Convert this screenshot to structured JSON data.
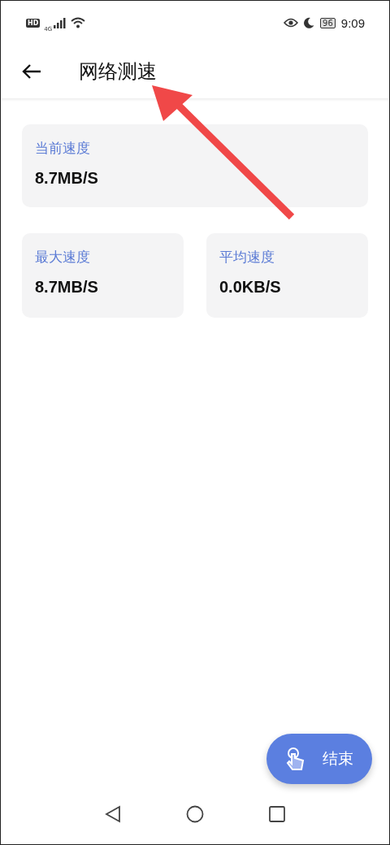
{
  "status_bar": {
    "hd": "HD",
    "network": "4G",
    "battery": "96",
    "time": "9:09"
  },
  "header": {
    "title": "网络测速"
  },
  "stats": [
    {
      "label": "当前速度",
      "value": "8.7MB/S",
      "wide": true
    },
    {
      "label": "最大速度",
      "value": "8.7MB/S",
      "wide": false
    },
    {
      "label": "平均速度",
      "value": "0.0KB/S",
      "wide": false
    }
  ],
  "fab": {
    "label": "结束"
  }
}
